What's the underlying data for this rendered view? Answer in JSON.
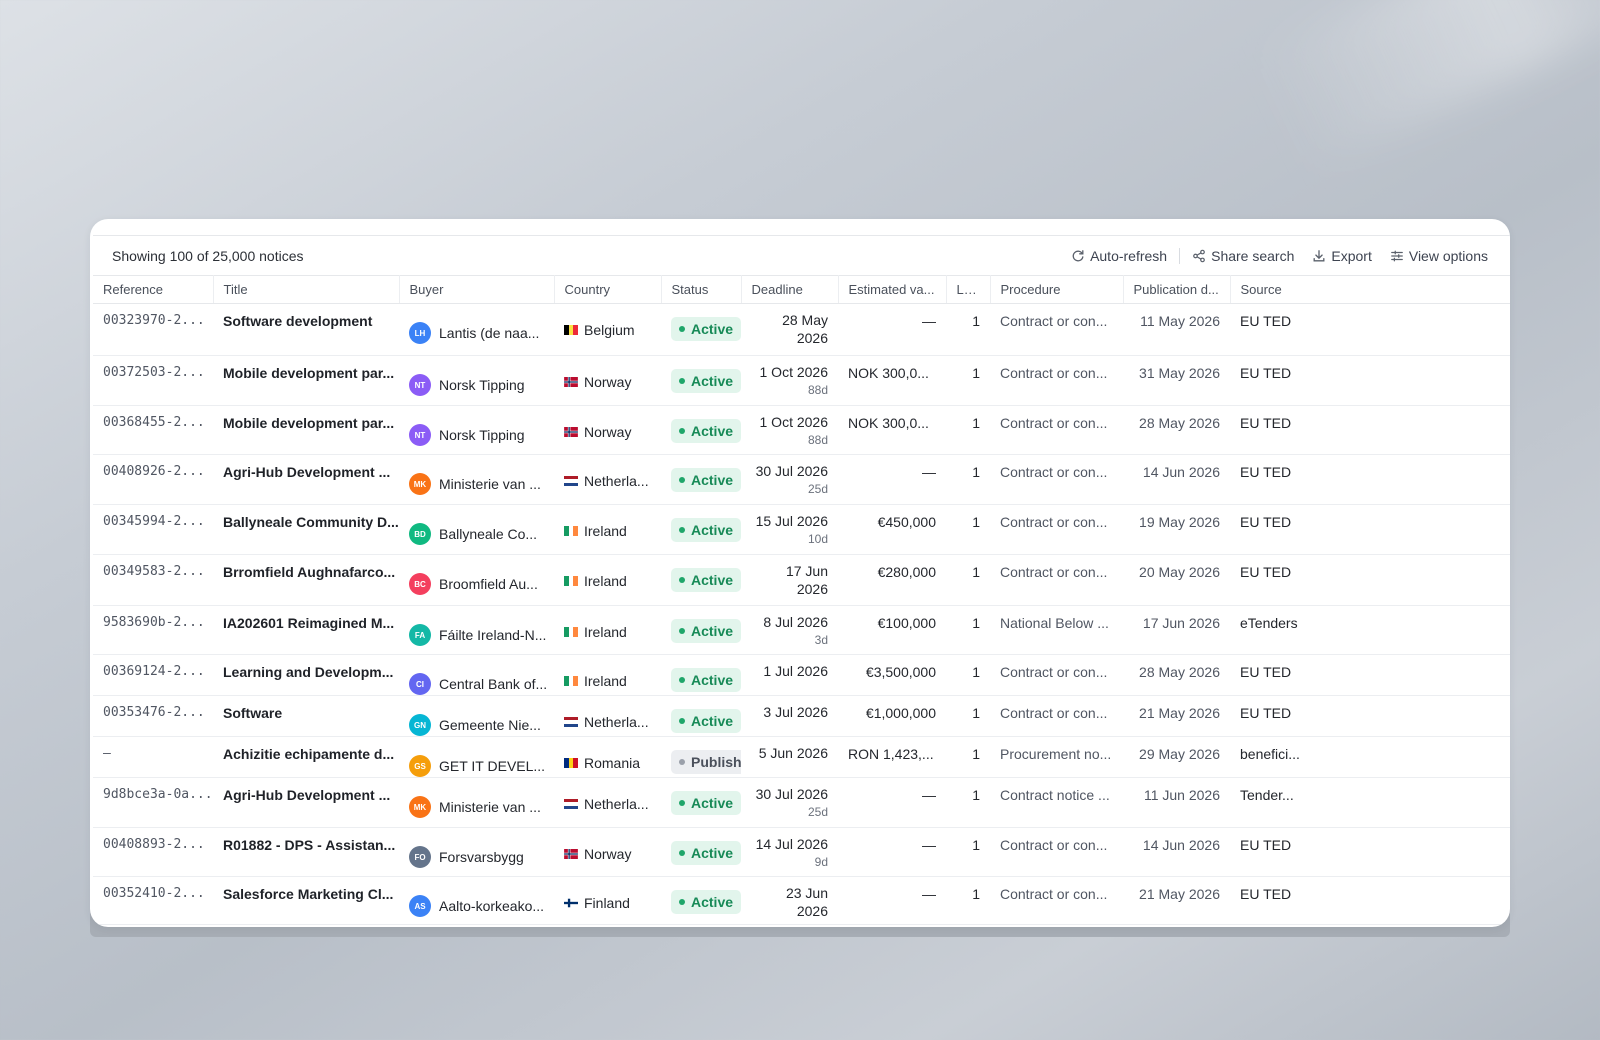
{
  "toolbar": {
    "summary": "Showing 100 of 25,000 notices",
    "auto_refresh": "Auto-refresh",
    "share_search": "Share search",
    "export": "Export",
    "view_options": "View options",
    "icons": [
      "refresh-icon",
      "share-icon",
      "download-icon",
      "columns-icon"
    ]
  },
  "columns": [
    "Reference",
    "Title",
    "Buyer",
    "Country",
    "Status",
    "Deadline",
    "Estimated va...",
    "Lots",
    "Procedure",
    "Publication d...",
    "Source"
  ],
  "status_colors": {
    "active": "#1fa66a",
    "published": "#9aa0aa"
  },
  "rows": [
    {
      "ref": "00323970-2...",
      "title": "Software development",
      "buyer": "Lantis (de naa...",
      "initials": "LH",
      "avatar_color": "#3b82f6",
      "country": "Belgium",
      "flag": "be",
      "status": "Active",
      "deadline": "28 May\n2026",
      "deadline_sub": "",
      "value": "—",
      "lots": "1",
      "procedure": "Contract or con...",
      "published": "11 May 2026",
      "source": "EU TED"
    },
    {
      "ref": "00372503-2...",
      "title": "Mobile development par...",
      "buyer": "Norsk Tipping",
      "initials": "NT",
      "avatar_color": "#8b5cf6",
      "country": "Norway",
      "flag": "no",
      "status": "Active",
      "deadline": "1 Oct 2026",
      "deadline_sub": "88d",
      "value": "NOK 300,0...",
      "lots": "1",
      "procedure": "Contract or con...",
      "published": "31 May 2026",
      "source": "EU TED"
    },
    {
      "ref": "00368455-2...",
      "title": "Mobile development par...",
      "buyer": "Norsk Tipping",
      "initials": "NT",
      "avatar_color": "#8b5cf6",
      "country": "Norway",
      "flag": "no",
      "status": "Active",
      "deadline": "1 Oct 2026",
      "deadline_sub": "88d",
      "value": "NOK 300,0...",
      "lots": "1",
      "procedure": "Contract or con...",
      "published": "28 May 2026",
      "source": "EU TED"
    },
    {
      "ref": "00408926-2...",
      "title": "Agri-Hub Development ...",
      "buyer": "Ministerie van ...",
      "initials": "MK",
      "avatar_color": "#f97316",
      "country": "Netherla...",
      "flag": "nl",
      "status": "Active",
      "deadline": "30 Jul 2026",
      "deadline_sub": "25d",
      "value": "—",
      "lots": "1",
      "procedure": "Contract or con...",
      "published": "14 Jun 2026",
      "source": "EU TED"
    },
    {
      "ref": "00345994-2...",
      "title": "Ballyneale Community D...",
      "buyer": "Ballyneale Co...",
      "initials": "BD",
      "avatar_color": "#10b981",
      "country": "Ireland",
      "flag": "ie",
      "status": "Active",
      "deadline": "15 Jul 2026",
      "deadline_sub": "10d",
      "value": "€450,000",
      "lots": "1",
      "procedure": "Contract or con...",
      "published": "19 May 2026",
      "source": "EU TED"
    },
    {
      "ref": "00349583-2...",
      "title": "Brromfield Aughnafarco...",
      "buyer": "Broomfield Au...",
      "initials": "BC",
      "avatar_color": "#f43f5e",
      "country": "Ireland",
      "flag": "ie",
      "status": "Active",
      "deadline": "17 Jun\n2026",
      "deadline_sub": "",
      "value": "€280,000",
      "lots": "1",
      "procedure": "Contract or con...",
      "published": "20 May 2026",
      "source": "EU TED"
    },
    {
      "ref": "9583690b-2...",
      "title": "IA202601 Reimagined M...",
      "buyer": "Fáilte Ireland-N...",
      "initials": "FA",
      "avatar_color": "#14b8a6",
      "country": "Ireland",
      "flag": "ie",
      "status": "Active",
      "deadline": "8 Jul 2026",
      "deadline_sub": "3d",
      "value": "€100,000",
      "lots": "1",
      "procedure": "National Below ...",
      "published": "17 Jun 2026",
      "source": "eTenders"
    },
    {
      "ref": "00369124-2...",
      "title": "Learning and Developm...",
      "buyer": "Central Bank of...",
      "initials": "CI",
      "avatar_color": "#6366f1",
      "country": "Ireland",
      "flag": "ie",
      "status": "Active",
      "deadline": "1 Jul 2026",
      "deadline_sub": "",
      "value": "€3,500,000",
      "lots": "1",
      "procedure": "Contract or con...",
      "published": "28 May 2026",
      "source": "EU TED"
    },
    {
      "ref": "00353476-2...",
      "title": "Software",
      "buyer": "Gemeente Nie...",
      "initials": "GN",
      "avatar_color": "#06b6d4",
      "country": "Netherla...",
      "flag": "nl",
      "status": "Active",
      "deadline": "3 Jul 2026",
      "deadline_sub": "",
      "value": "€1,000,000",
      "lots": "1",
      "procedure": "Contract or con...",
      "published": "21 May 2026",
      "source": "EU TED"
    },
    {
      "ref": "—",
      "title": "Achizitie echipamente d...",
      "buyer": "GET IT DEVEL...",
      "initials": "GS",
      "avatar_color": "#f59e0b",
      "country": "Romania",
      "flag": "ro",
      "status": "Published",
      "deadline": "5 Jun 2026",
      "deadline_sub": "",
      "value": "RON 1,423,...",
      "lots": "1",
      "procedure": "Procurement no...",
      "published": "29 May 2026",
      "source": "benefici..."
    },
    {
      "ref": "9d8bce3a-0a...",
      "title": "Agri-Hub Development ...",
      "buyer": "Ministerie van ...",
      "initials": "MK",
      "avatar_color": "#f97316",
      "country": "Netherla...",
      "flag": "nl",
      "status": "Active",
      "deadline": "30 Jul 2026",
      "deadline_sub": "25d",
      "value": "—",
      "lots": "1",
      "procedure": "Contract notice ...",
      "published": "11 Jun 2026",
      "source": "Tender..."
    },
    {
      "ref": "00408893-2...",
      "title": "R01882 - DPS - Assistan...",
      "buyer": "Forsvarsbygg",
      "initials": "FO",
      "avatar_color": "#64748b",
      "country": "Norway",
      "flag": "no",
      "status": "Active",
      "deadline": "14 Jul 2026",
      "deadline_sub": "9d",
      "value": "—",
      "lots": "1",
      "procedure": "Contract or con...",
      "published": "14 Jun 2026",
      "source": "EU TED"
    },
    {
      "ref": "00352410-2...",
      "title": "Salesforce Marketing Cl...",
      "buyer": "Aalto-korkeako...",
      "initials": "AS",
      "avatar_color": "#3b82f6",
      "country": "Finland",
      "flag": "fi",
      "status": "Active",
      "deadline": "23 Jun\n2026",
      "deadline_sub": "",
      "value": "—",
      "lots": "1",
      "procedure": "Contract or con...",
      "published": "21 May 2026",
      "source": "EU TED"
    }
  ]
}
